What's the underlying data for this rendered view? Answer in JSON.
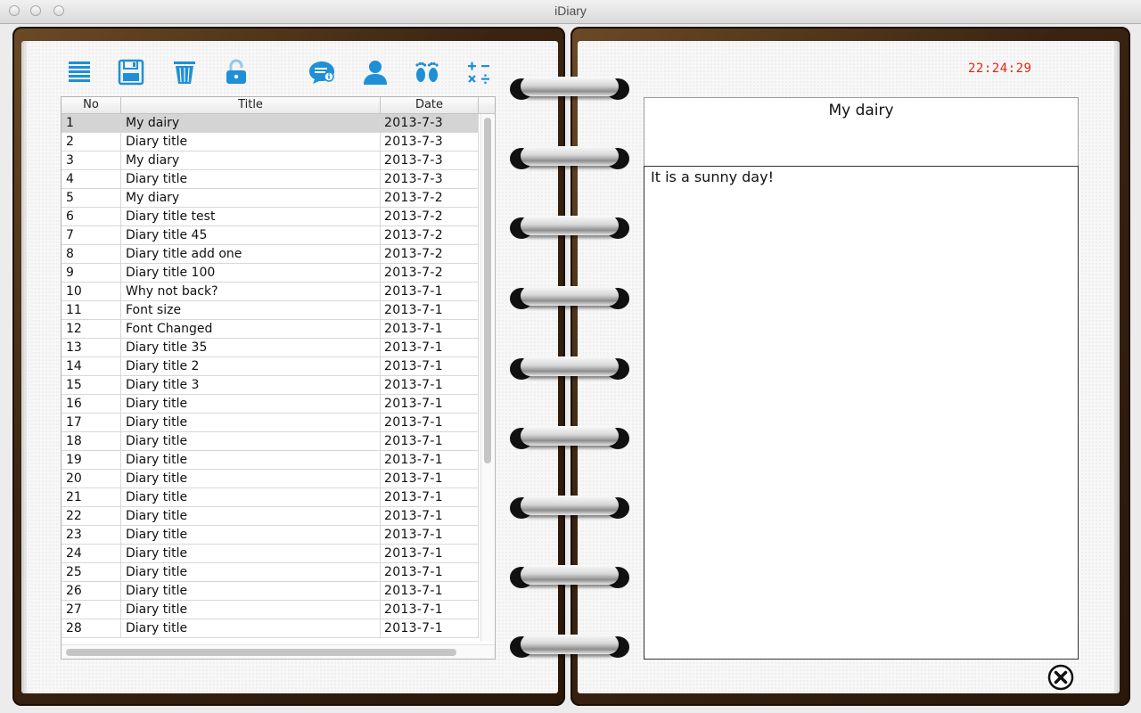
{
  "window": {
    "title": "iDiary"
  },
  "toolbar": {
    "icons": [
      "list-icon",
      "save-icon",
      "trash-icon",
      "unlock-icon",
      "message-info-icon",
      "user-icon",
      "footprints-icon",
      "calculator-icon"
    ]
  },
  "table": {
    "columns": {
      "no": "No",
      "title": "Title",
      "date": "Date"
    },
    "rows": [
      {
        "no": "1",
        "title": "My dairy",
        "date": "2013-7-3"
      },
      {
        "no": "2",
        "title": "Diary title",
        "date": "2013-7-3"
      },
      {
        "no": "3",
        "title": "My diary",
        "date": "2013-7-3"
      },
      {
        "no": "4",
        "title": "Diary title",
        "date": "2013-7-3"
      },
      {
        "no": "5",
        "title": "My diary",
        "date": "2013-7-2"
      },
      {
        "no": "6",
        "title": "Diary title test",
        "date": "2013-7-2"
      },
      {
        "no": "7",
        "title": "Diary title 45",
        "date": "2013-7-2"
      },
      {
        "no": "8",
        "title": "Diary title add one",
        "date": "2013-7-2"
      },
      {
        "no": "9",
        "title": "Diary title 100",
        "date": "2013-7-2"
      },
      {
        "no": "10",
        "title": "Why not back?",
        "date": "2013-7-1"
      },
      {
        "no": "11",
        "title": "Font size",
        "date": "2013-7-1"
      },
      {
        "no": "12",
        "title": "Font Changed",
        "date": "2013-7-1"
      },
      {
        "no": "13",
        "title": "Diary title 35",
        "date": "2013-7-1"
      },
      {
        "no": "14",
        "title": "Diary title 2",
        "date": "2013-7-1"
      },
      {
        "no": "15",
        "title": "Diary title 3",
        "date": "2013-7-1"
      },
      {
        "no": "16",
        "title": "Diary title",
        "date": "2013-7-1"
      },
      {
        "no": "17",
        "title": "Diary title",
        "date": "2013-7-1"
      },
      {
        "no": "18",
        "title": "Diary title",
        "date": "2013-7-1"
      },
      {
        "no": "19",
        "title": "Diary title",
        "date": "2013-7-1"
      },
      {
        "no": "20",
        "title": "Diary title",
        "date": "2013-7-1"
      },
      {
        "no": "21",
        "title": "Diary title",
        "date": "2013-7-1"
      },
      {
        "no": "22",
        "title": "Diary title",
        "date": "2013-7-1"
      },
      {
        "no": "23",
        "title": "Diary title",
        "date": "2013-7-1"
      },
      {
        "no": "24",
        "title": "Diary title",
        "date": "2013-7-1"
      },
      {
        "no": "25",
        "title": "Diary title",
        "date": "2013-7-1"
      },
      {
        "no": "26",
        "title": "Diary title",
        "date": "2013-7-1"
      },
      {
        "no": "27",
        "title": "Diary title",
        "date": "2013-7-1"
      },
      {
        "no": "28",
        "title": "Diary title",
        "date": "2013-7-1"
      }
    ],
    "selected_row": 0
  },
  "entry": {
    "clock": "22:24:29",
    "title": "My dairy",
    "body": "It is a sunny day!"
  },
  "colors": {
    "accent": "#1f8fd6",
    "clock": "#e2231a",
    "cover": "#3a2411"
  }
}
